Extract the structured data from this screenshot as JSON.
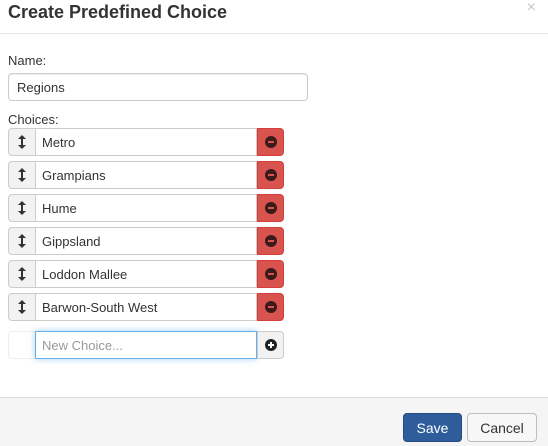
{
  "modal": {
    "title": "Create Predefined Choice",
    "close_symbol": "×"
  },
  "form": {
    "name_label": "Name:",
    "name_value": "Regions",
    "choices_label": "Choices:",
    "choices": [
      {
        "value": "Metro"
      },
      {
        "value": "Grampians"
      },
      {
        "value": "Hume"
      },
      {
        "value": "Gippsland"
      },
      {
        "value": "Loddon Mallee"
      },
      {
        "value": "Barwon-South West"
      }
    ],
    "new_choice_placeholder": "New Choice...",
    "new_choice_value": ""
  },
  "footer": {
    "save_label": "Save",
    "cancel_label": "Cancel"
  },
  "icons": {
    "drag": "updown-arrow-icon",
    "remove": "minus-circle-icon",
    "add": "plus-circle-icon",
    "close": "close-icon"
  },
  "colors": {
    "remove_button": "#d9534f",
    "save_button": "#2f5d9c",
    "focus_border": "#66afe9"
  }
}
